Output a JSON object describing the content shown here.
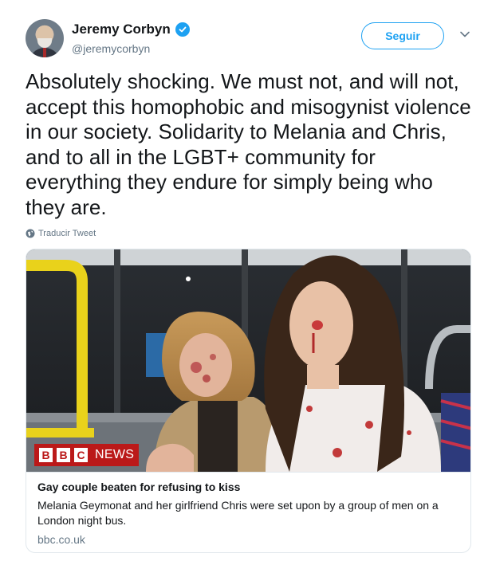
{
  "author": {
    "display_name": "Jeremy Corbyn",
    "handle": "@jeremycorbyn",
    "verified": true
  },
  "actions": {
    "follow_label": "Seguir"
  },
  "tweet": {
    "text": "Absolutely shocking. We must not, and will not, accept this homophobic and misogynist violence in our society. Solidarity to Melania and Chris, and to all in the LGBT+ community for everything they endure for simply being who they are.",
    "translate_label": "Traducir Tweet"
  },
  "card": {
    "logo": {
      "letters": [
        "B",
        "B",
        "C"
      ],
      "suffix": "NEWS"
    },
    "title": "Gay couple beaten for refusing to kiss",
    "description": "Melania Geymonat and her girlfriend Chris were set upon by a group of men on a London night bus.",
    "domain": "bbc.co.uk"
  },
  "colors": {
    "accent": "#1da1f2",
    "text": "#14171a",
    "muted": "#657786",
    "bbc_red": "#bb1919"
  },
  "icons": {
    "verified": "verified-check-icon",
    "chevron": "chevron-down-icon",
    "translate": "globe-icon"
  }
}
